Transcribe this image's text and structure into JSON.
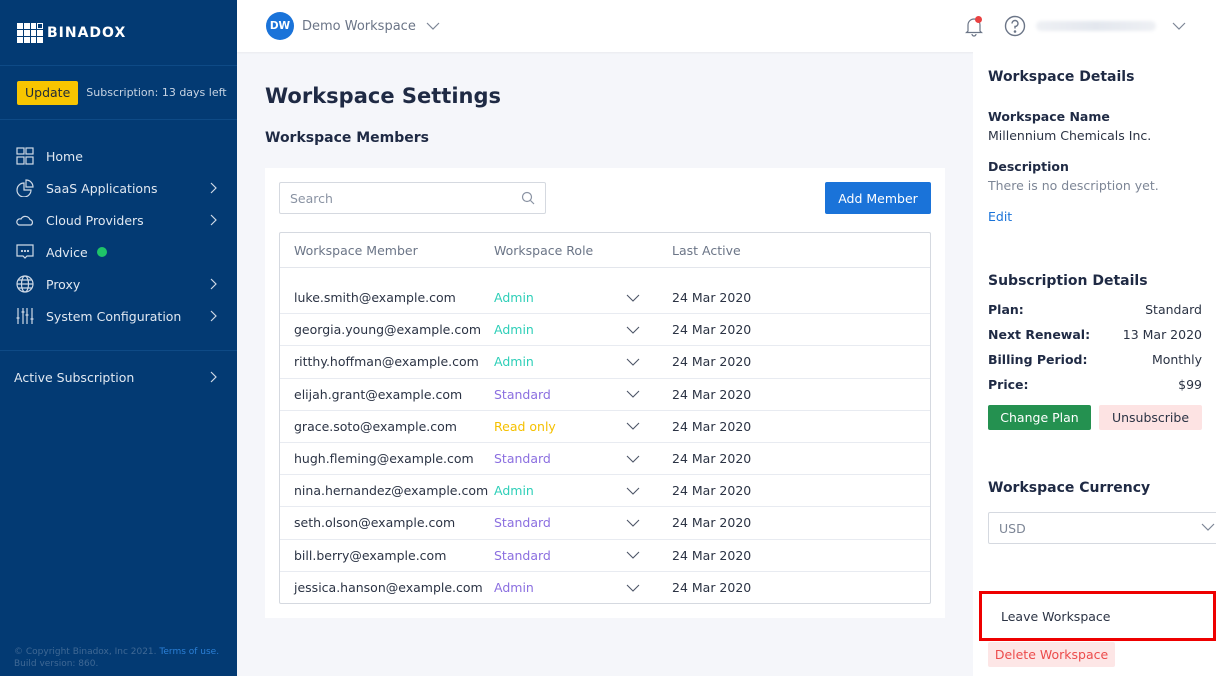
{
  "sidebar": {
    "logo_text": "BINADOX",
    "update_label": "Update",
    "subscription_text": "Subscription: 13 days left",
    "items": [
      {
        "label": "Home",
        "icon": "home-grid-icon",
        "has_chevron": false
      },
      {
        "label": "SaaS Applications",
        "icon": "pie-chart-icon",
        "has_chevron": true
      },
      {
        "label": "Cloud Providers",
        "icon": "cloud-icon",
        "has_chevron": true
      },
      {
        "label": "Advice",
        "icon": "chat-bubble-icon",
        "has_chevron": false,
        "badge_color": "#1fc468"
      },
      {
        "label": "Proxy",
        "icon": "globe-icon",
        "has_chevron": true
      },
      {
        "label": "System Configuration",
        "icon": "sliders-icon",
        "has_chevron": true
      }
    ],
    "active_subscription": "Active Subscription",
    "footer_copyright": "© Copyright Binadox, Inc 2021.",
    "footer_terms": "Terms of use.",
    "footer_build": "Build version: 860."
  },
  "topbar": {
    "workspace_initials": "DW",
    "workspace_name": "Demo Workspace",
    "notification_dot_color": "#e94141",
    "user_email": "[redacted]"
  },
  "main": {
    "page_title": "Workspace Settings",
    "section_title": "Workspace Members",
    "search_placeholder": "Search",
    "add_member_label": "Add Member",
    "columns": [
      "Workspace Member",
      "Workspace Role",
      "Last Active"
    ],
    "members": [
      {
        "email": "luke.smith@example.com",
        "role": "Admin",
        "role_color": "#2ecfb8",
        "last_active": "24 Mar 2020"
      },
      {
        "email": "georgia.young@example.com",
        "role": "Admin",
        "role_color": "#2ecfb8",
        "last_active": "24 Mar 2020"
      },
      {
        "email": "ritthy.hoffman@example.com",
        "role": "Admin",
        "role_color": "#2ecfb8",
        "last_active": "24 Mar 2020"
      },
      {
        "email": "elijah.grant@example.com",
        "role": "Standard",
        "role_color": "#8b6fe0",
        "last_active": "24 Mar 2020"
      },
      {
        "email": "grace.soto@example.com",
        "role": "Read only",
        "role_color": "#f5c000",
        "last_active": "24 Mar 2020"
      },
      {
        "email": "hugh.fleming@example.com",
        "role": "Standard",
        "role_color": "#8b6fe0",
        "last_active": "24 Mar 2020"
      },
      {
        "email": "nina.hernandez@example.com",
        "role": "Admin",
        "role_color": "#2ecfb8",
        "last_active": "24 Mar 2020"
      },
      {
        "email": "seth.olson@example.com",
        "role": "Standard",
        "role_color": "#8b6fe0",
        "last_active": "24 Mar 2020"
      },
      {
        "email": "bill.berry@example.com",
        "role": "Standard",
        "role_color": "#8b6fe0",
        "last_active": "24 Mar 2020"
      },
      {
        "email": "jessica.hanson@example.com",
        "role": "Admin",
        "role_color": "#8b6fe0",
        "last_active": "24 Mar 2020"
      }
    ]
  },
  "details": {
    "title": "Workspace Details",
    "name_label": "Workspace Name",
    "name_value": "Millennium Chemicals Inc.",
    "description_label": "Description",
    "description_value": "There is no description yet.",
    "edit_label": "Edit"
  },
  "subscription": {
    "title": "Subscription Details",
    "rows": [
      {
        "key": "Plan:",
        "value": "Standard"
      },
      {
        "key": "Next Renewal:",
        "value": "13 Mar 2020"
      },
      {
        "key": "Billing Period:",
        "value": "Monthly"
      },
      {
        "key": "Price:",
        "value": "$99"
      }
    ],
    "change_plan_label": "Change Plan",
    "unsubscribe_label": "Unsubscribe"
  },
  "currency": {
    "title": "Workspace Currency",
    "selected": "USD"
  },
  "actions": {
    "leave_label": "Leave Workspace",
    "delete_label": "Delete Workspace",
    "highlight_color": "#ee0000"
  }
}
